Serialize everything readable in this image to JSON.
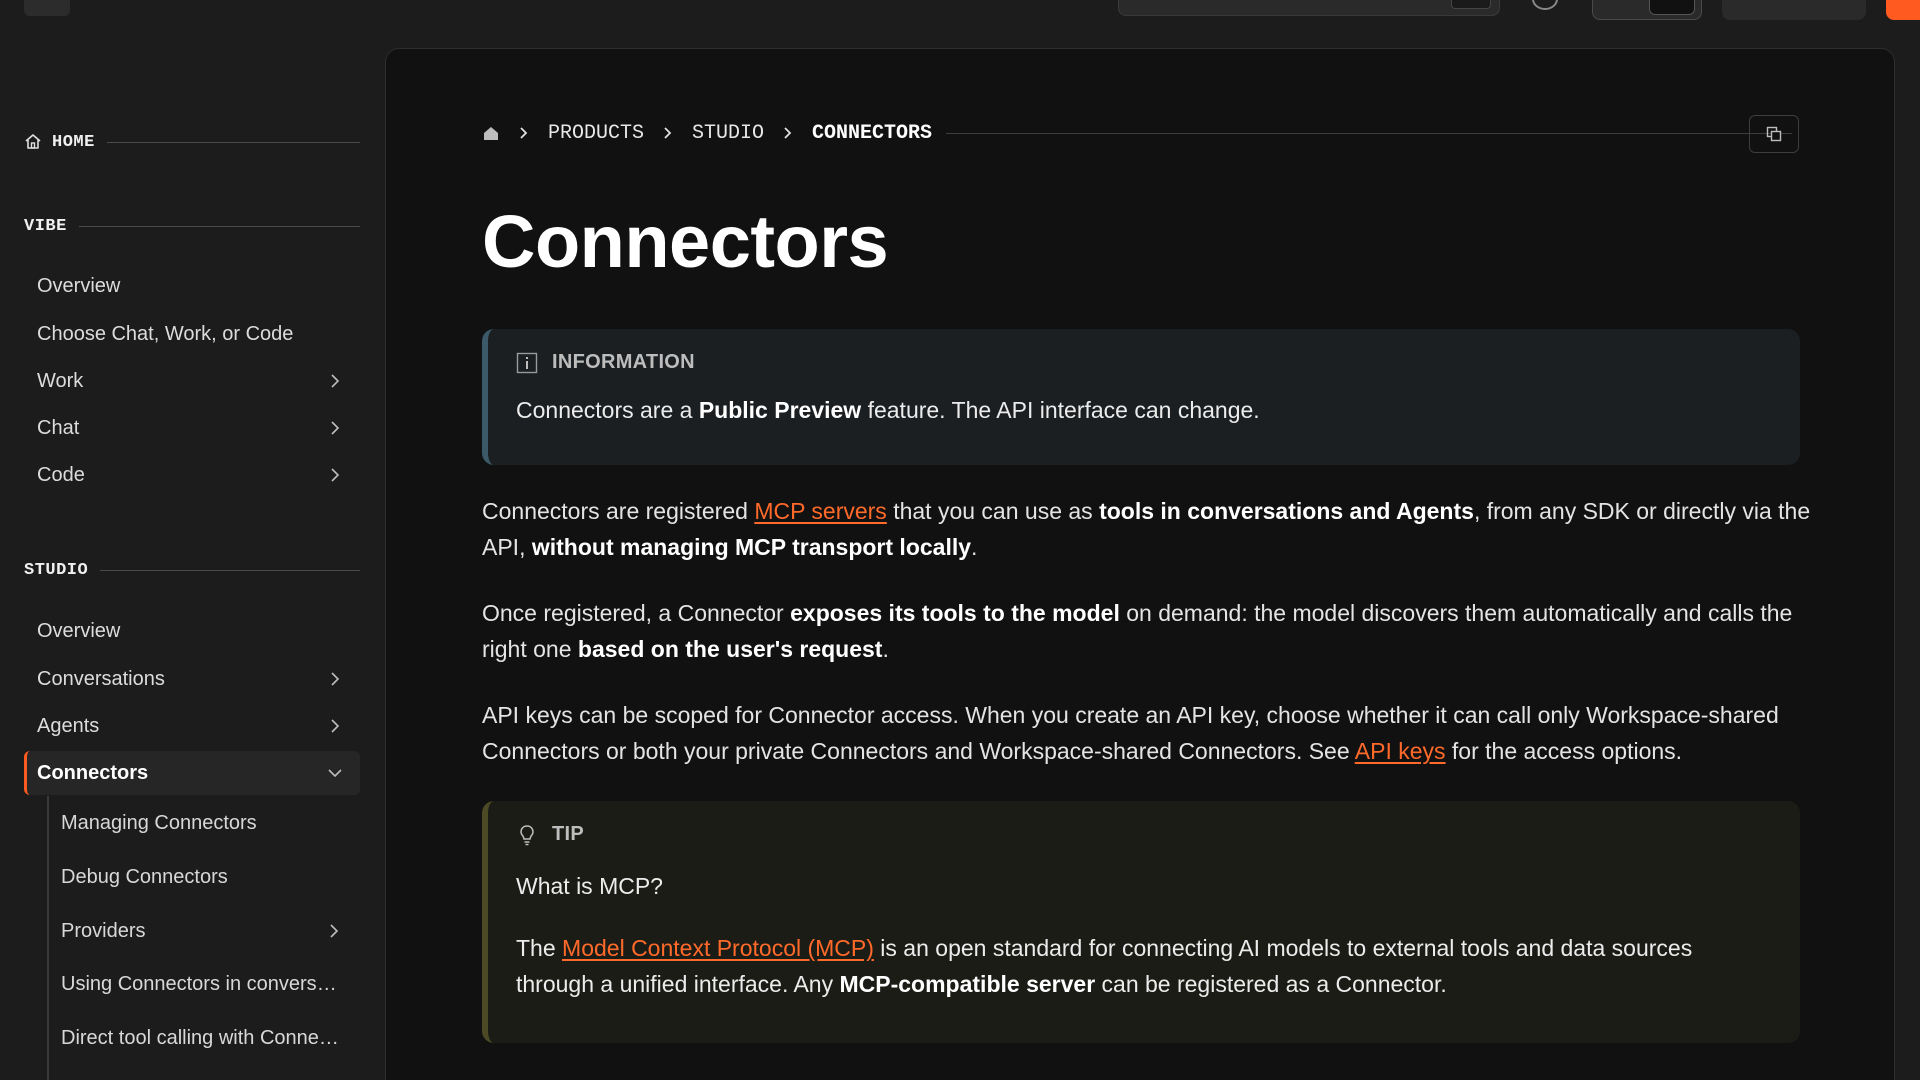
{
  "sidebar": {
    "home": {
      "label": "HOME"
    },
    "vibe": {
      "label": "VIBE",
      "items": [
        {
          "label": "Overview"
        },
        {
          "label": "Choose Chat, Work, or Code"
        },
        {
          "label": "Work"
        },
        {
          "label": "Chat"
        },
        {
          "label": "Code"
        }
      ]
    },
    "studio": {
      "label": "STUDIO",
      "items": [
        {
          "label": "Overview"
        },
        {
          "label": "Conversations"
        },
        {
          "label": "Agents"
        },
        {
          "label": "Connectors"
        }
      ],
      "sub_items": [
        {
          "label": "Managing Connectors"
        },
        {
          "label": "Debug Connectors"
        },
        {
          "label": "Providers"
        },
        {
          "label": "Using Connectors in conversations"
        },
        {
          "label": "Direct tool calling with Connectors"
        }
      ]
    }
  },
  "breadcrumb": {
    "items": [
      "PRODUCTS",
      "STUDIO",
      "CONNECTORS"
    ]
  },
  "page": {
    "title": "Connectors"
  },
  "info_callout": {
    "heading": "INFORMATION",
    "text_1": "Connectors are a ",
    "bold_1": "Public Preview",
    "text_2": " feature. The API interface can change."
  },
  "para1": {
    "t1": "Connectors are registered ",
    "link1": "MCP servers",
    "t2": " that you can use as ",
    "b1": "tools in conversations and Agents",
    "t3": ", from any SDK or directly via the API, ",
    "b2": "without managing MCP transport locally",
    "t4": "."
  },
  "para2": {
    "t1": "Once registered, a Connector ",
    "b1": "exposes its tools to the model",
    "t2": " on demand: the model discovers them automatically and calls the right one ",
    "b2": "based on the user's request",
    "t3": "."
  },
  "para3": {
    "t1": "API keys can be scoped for Connector access. When you create an API key, choose whether it can call only Workspace-shared Connectors or both your private Connectors and Workspace-shared Connectors. See ",
    "link1": "API keys",
    "t2": " for the access options."
  },
  "tip_callout": {
    "heading": "TIP",
    "question": "What is MCP?",
    "t1": "The ",
    "link1": "Model Context Protocol (MCP)",
    "t2": " is an open standard for connecting AI models to external tools and data sources through a unified interface. Any ",
    "b1": "MCP-compatible server",
    "t3": " can be registered as a Connector."
  },
  "colors": {
    "accent": "#ff5a1f",
    "link": "#ff6a2a",
    "info_border": "#3b5968",
    "tip_border": "#4b4a24"
  },
  "icons": {
    "home": "home-icon",
    "chevron": "chevron-right-icon",
    "expanded": "chevron-down-icon",
    "copy": "copy-icon",
    "info": "info-icon",
    "tip": "lightbulb-icon"
  }
}
